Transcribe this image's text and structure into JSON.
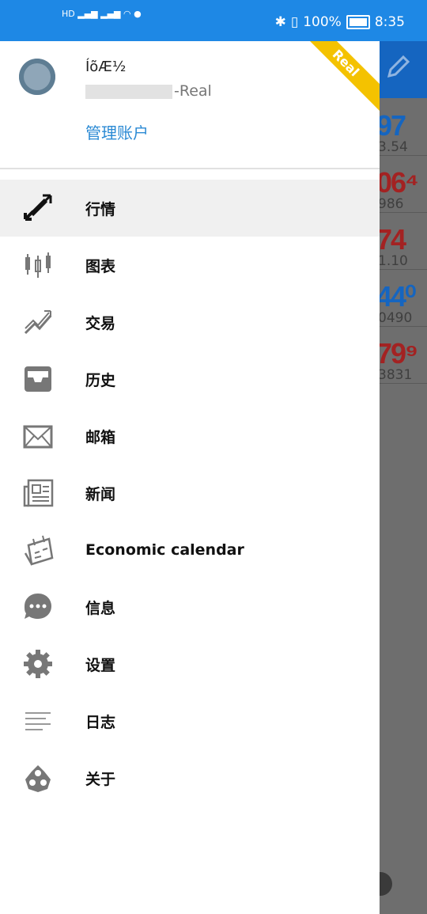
{
  "status_bar": {
    "left_icons": [
      "HD",
      "4G",
      "signal",
      "4G",
      "signal",
      "wifi",
      "app-notification"
    ],
    "battery": "100%",
    "time": "8:35"
  },
  "account": {
    "name": "Í­õÆ½",
    "suffix": "-Real",
    "badge": "Real",
    "manage_label": "管理账户"
  },
  "menu": {
    "items": [
      {
        "label": "行情",
        "icon": "quotes-arrows-icon",
        "active": true
      },
      {
        "label": "图表",
        "icon": "candlestick-chart-icon"
      },
      {
        "label": "交易",
        "icon": "trade-trend-icon"
      },
      {
        "label": "历史",
        "icon": "history-inbox-icon"
      },
      {
        "label": "邮箱",
        "icon": "mail-envelope-icon"
      },
      {
        "label": "新闻",
        "icon": "news-icon"
      },
      {
        "label": "Economic calendar",
        "icon": "economic-calendar-icon"
      },
      {
        "label": "信息",
        "icon": "chat-bubble-icon"
      },
      {
        "label": "设置",
        "icon": "gear-icon"
      },
      {
        "label": "日志",
        "icon": "log-lines-icon"
      },
      {
        "label": "关于",
        "icon": "about-logo-icon"
      }
    ]
  },
  "background_quotes": [
    {
      "big": "97",
      "small": "3.54",
      "color": "#1565c0"
    },
    {
      "big": "06⁴",
      "small": "986",
      "color": "#a32222"
    },
    {
      "big": "74",
      "small": "1.10",
      "color": "#a32222"
    },
    {
      "big": "44⁰",
      "small": "0490",
      "color": "#1565c0"
    },
    {
      "big": "79⁹",
      "small": "3831",
      "color": "#a32222"
    }
  ]
}
